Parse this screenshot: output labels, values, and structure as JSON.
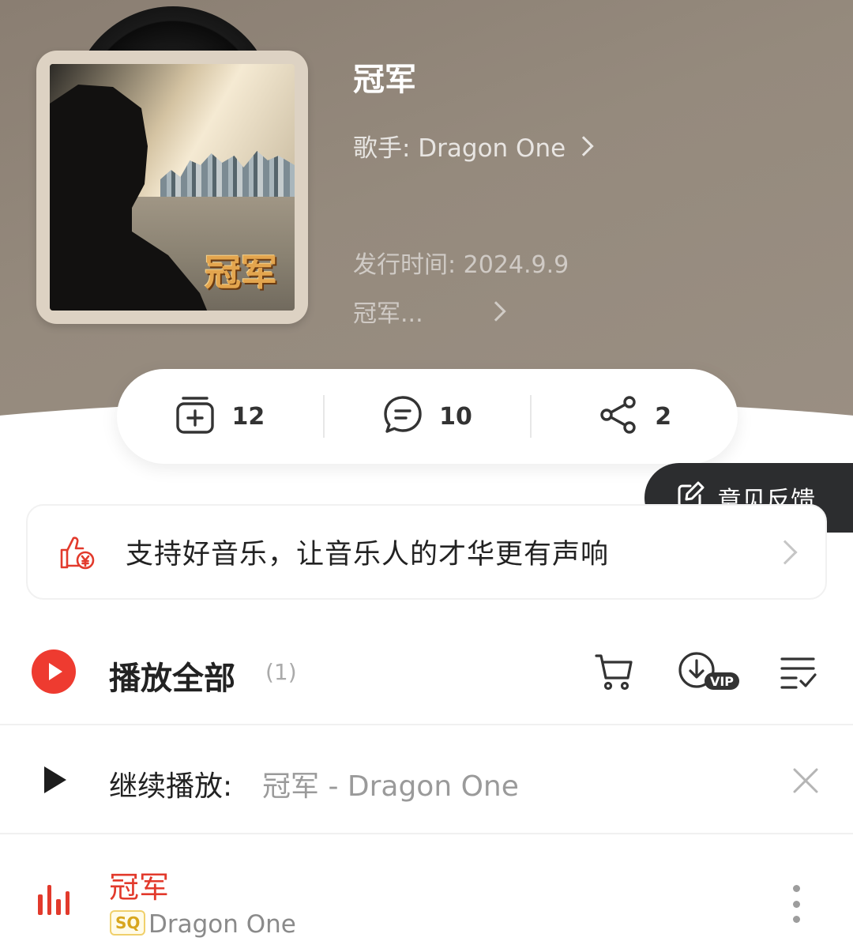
{
  "album": {
    "title": "冠军",
    "artist_text": "歌手: Dragon One",
    "release_text": "发行时间: 2024.9.9",
    "description_text": "冠军...",
    "cover_title": "冠军"
  },
  "stats": {
    "collect_count": "12",
    "comment_count": "10",
    "share_count": "2"
  },
  "feedback": {
    "label": "意见反馈"
  },
  "support": {
    "text": "支持好音乐，让音乐人的才华更有声响"
  },
  "playall": {
    "label": "播放全部",
    "count": "(1)"
  },
  "continue": {
    "label": "继续播放:",
    "track": "冠军 - Dragon One"
  },
  "songs": [
    {
      "title": "冠军",
      "quality": "SQ",
      "artist": "Dragon One"
    }
  ],
  "colors": {
    "accent": "#ee3b30",
    "header_bg": "#958a7d",
    "feedback_bg": "#2c2d2f"
  },
  "icons": {
    "collect": "collect-add-icon",
    "comment": "comment-icon",
    "share": "share-icon",
    "feedback": "edit-icon",
    "support": "thumbs-up-icon",
    "cart": "cart-icon",
    "download": "download-vip-icon",
    "multiselect": "multi-select-icon",
    "close": "close-icon"
  }
}
